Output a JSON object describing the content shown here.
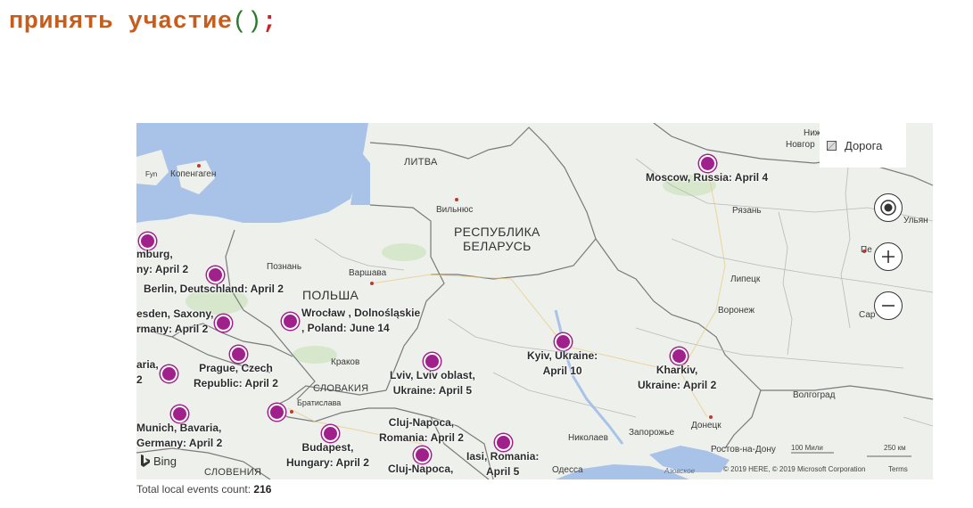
{
  "heading": {
    "keyword": "принять участие",
    "parens": "()",
    "semicolon": ";"
  },
  "map": {
    "legend_label": "Дорога",
    "icons": {
      "locate": "locate-icon",
      "zoom_in": "plus-icon",
      "zoom_out": "minus-icon",
      "logo": "bing-logo-icon"
    },
    "colors": {
      "pin": "#a0208c",
      "water": "#a9c3e8",
      "land": "#eef0ec",
      "border": "#7a7a7a"
    },
    "bing_label": "Bing",
    "copyright": "© 2019 HERE, © 2019 Microsoft Corporation",
    "terms": "Terms",
    "scale_miles": "100 Мили",
    "scale_km": "250 км",
    "countries": {
      "litva": "ЛИТВА",
      "belarus_1": "РЕСПУБЛИКА",
      "belarus_2": "БЕЛАРУСЬ",
      "polska": "ПОЛЬША",
      "slovakia": "СЛОВАКИЯ",
      "slovenia": "СЛОВЕНИЯ"
    },
    "cities": {
      "kopenhagen": "Копенгаген",
      "fyn": "Fyn",
      "vilnius": "Вильнюс",
      "poznan": "Познань",
      "warszawa": "Варшава",
      "krakow": "Краков",
      "bratislava": "Братислава",
      "nizhny_1": "Нижн",
      "nizhny_2": "Новгор",
      "ryazan": "Рязань",
      "ulyanovsk": "Ульян",
      "penza": "Пе",
      "lipetsk": "Липецк",
      "voronezh": "Воронеж",
      "saratov": "Сар",
      "volgograd": "Волгоград",
      "donetsk": "Донецк",
      "zaporozhye": "Запорожье",
      "nikolaev": "Николаев",
      "rostov": "Ростов-на-Дону",
      "odessa": "Одесса",
      "azov": "Азовское"
    },
    "events": [
      {
        "id": "moscow",
        "l1": "Moscow, Russia: April 4",
        "l2": ""
      },
      {
        "id": "hamburg",
        "l1": "mburg,",
        "l2": "ny: April 2"
      },
      {
        "id": "berlin",
        "l1": "Berlin, Deutschland: April 2",
        "l2": ""
      },
      {
        "id": "dresden",
        "l1": "esden, Saxony,",
        "l2": "rmany: April 2"
      },
      {
        "id": "wroclaw",
        "l1": "Wrocław , Dolnośląskie",
        "l2": ", Poland: June 14"
      },
      {
        "id": "bavaria",
        "l1": "aria,",
        "l2": "2"
      },
      {
        "id": "prague",
        "l1": "Prague, Czech",
        "l2": "Republic: April 2"
      },
      {
        "id": "munich",
        "l1": "Munich, Bavaria,",
        "l2": "Germany: April 2"
      },
      {
        "id": "lviv",
        "l1": "Lviv, Lviv oblast,",
        "l2": "Ukraine: April 5"
      },
      {
        "id": "kyiv",
        "l1": "Kyiv, Ukraine:",
        "l2": "April 10"
      },
      {
        "id": "kharkiv",
        "l1": "Kharkiv,",
        "l2": "Ukraine: April 2"
      },
      {
        "id": "cluj1",
        "l1": "Cluj-Napoca,",
        "l2": "Romania: April 2"
      },
      {
        "id": "budapest",
        "l1": "Budapest,",
        "l2": "Hungary: April 2"
      },
      {
        "id": "cluj2",
        "l1": "Cluj-Napoca,",
        "l2": ""
      },
      {
        "id": "iasi",
        "l1": "Iasi, Romania:",
        "l2": "April 5"
      }
    ]
  },
  "footer": {
    "label": "Total local events count:",
    "count": "216"
  }
}
